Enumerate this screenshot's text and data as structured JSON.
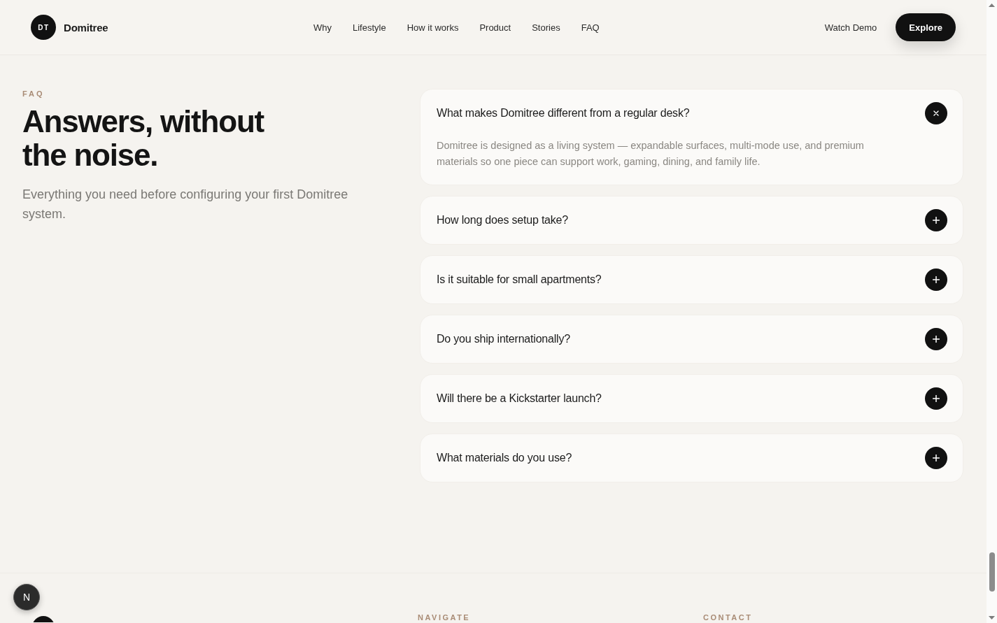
{
  "header": {
    "logo": {
      "initials": "DT",
      "name": "Domitree"
    },
    "nav": [
      "Why",
      "Lifestyle",
      "How it works",
      "Product",
      "Stories",
      "FAQ"
    ],
    "secondary_link": "Watch Demo",
    "cta": "Explore"
  },
  "faq_intro": {
    "eyebrow": "FAQ",
    "title": "Answers, without the noise.",
    "subtitle": "Everything you need before configuring your first Domitree system."
  },
  "faq_items": [
    {
      "question": "What makes Domitree different from a regular desk?",
      "expanded": true,
      "answer": "Domitree is designed as a living system — expandable surfaces, multi-mode use, and premium materials so one piece can support work, gaming, dining, and family life."
    },
    {
      "question": "How long does setup take?",
      "expanded": false
    },
    {
      "question": "Is it suitable for small apartments?",
      "expanded": false
    },
    {
      "question": "Do you ship internationally?",
      "expanded": false
    },
    {
      "question": "Will there be a Kickstarter launch?",
      "expanded": false
    },
    {
      "question": "What materials do you use?",
      "expanded": false
    }
  ],
  "footer": {
    "columns": [
      {
        "heading": "NAVIGATE"
      },
      {
        "heading": "CONTACT"
      }
    ]
  },
  "dev_badge": {
    "label": "N"
  }
}
